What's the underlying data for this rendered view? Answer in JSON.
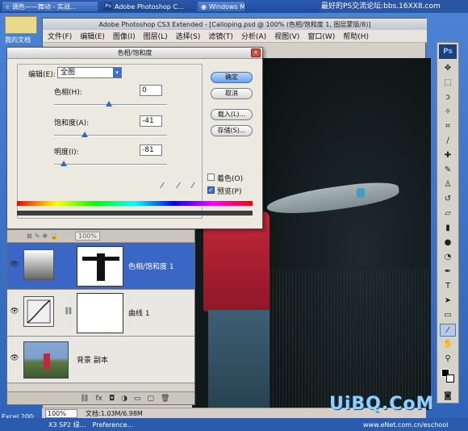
{
  "taskbar": {
    "items": [
      {
        "label": "调色——舞动 - 实战…",
        "icon": "ie-icon"
      },
      {
        "label": "Adobe Photoshop C…",
        "icon": "ps-icon"
      },
      {
        "label": "Windows M…",
        "icon": "media-icon"
      }
    ],
    "watermark": "最好的PS交流论坛:bbs.16XX8.com"
  },
  "desktop": {
    "my_docs": "我的文档",
    "excel": "Excel 200:",
    "sp2_label": "X3 SP2 绿…",
    "preference": "Preference…"
  },
  "ps": {
    "title": "Adobe Photoshop CS3 Extended - [Calloping.psd @ 100% (色相/饱和度 1, 图层蒙版/8)]",
    "logo": "Ps",
    "menu": [
      "文件(F)",
      "编辑(E)",
      "图像(I)",
      "图层(L)",
      "选择(S)",
      "滤镜(T)",
      "分析(A)",
      "视图(V)",
      "窗口(W)",
      "帮助(H)"
    ],
    "status": {
      "zoom": "100%",
      "doc": "文档:1.03M/6.98M"
    }
  },
  "dialog": {
    "title": "色相/饱和度",
    "edit_label": "编辑(E):",
    "edit_value": "全图",
    "hue_label": "色相(H):",
    "hue_value": "0",
    "sat_label": "饱和度(A):",
    "sat_value": "-41",
    "light_label": "明度(I):",
    "light_value": "-81",
    "ok": "确定",
    "cancel": "取消",
    "load": "载入(L)...",
    "save": "存储(S)...",
    "colorize": "着色(O)",
    "preview": "预览(P)"
  },
  "layers": {
    "opacity": "100%",
    "rows": [
      {
        "name": "色相/饱和度 1",
        "selected": true
      },
      {
        "name": "曲线 1",
        "selected": false
      },
      {
        "name": "背景 副本",
        "selected": false
      }
    ]
  },
  "watermark": {
    "logo": "UiBQ.CoM",
    "url": "www.eNet.com.cn/eschool"
  },
  "colors": {
    "selection": "#3a66c6",
    "accent_blue": "#3a6fd0",
    "shirt_red": "#c2283a"
  }
}
